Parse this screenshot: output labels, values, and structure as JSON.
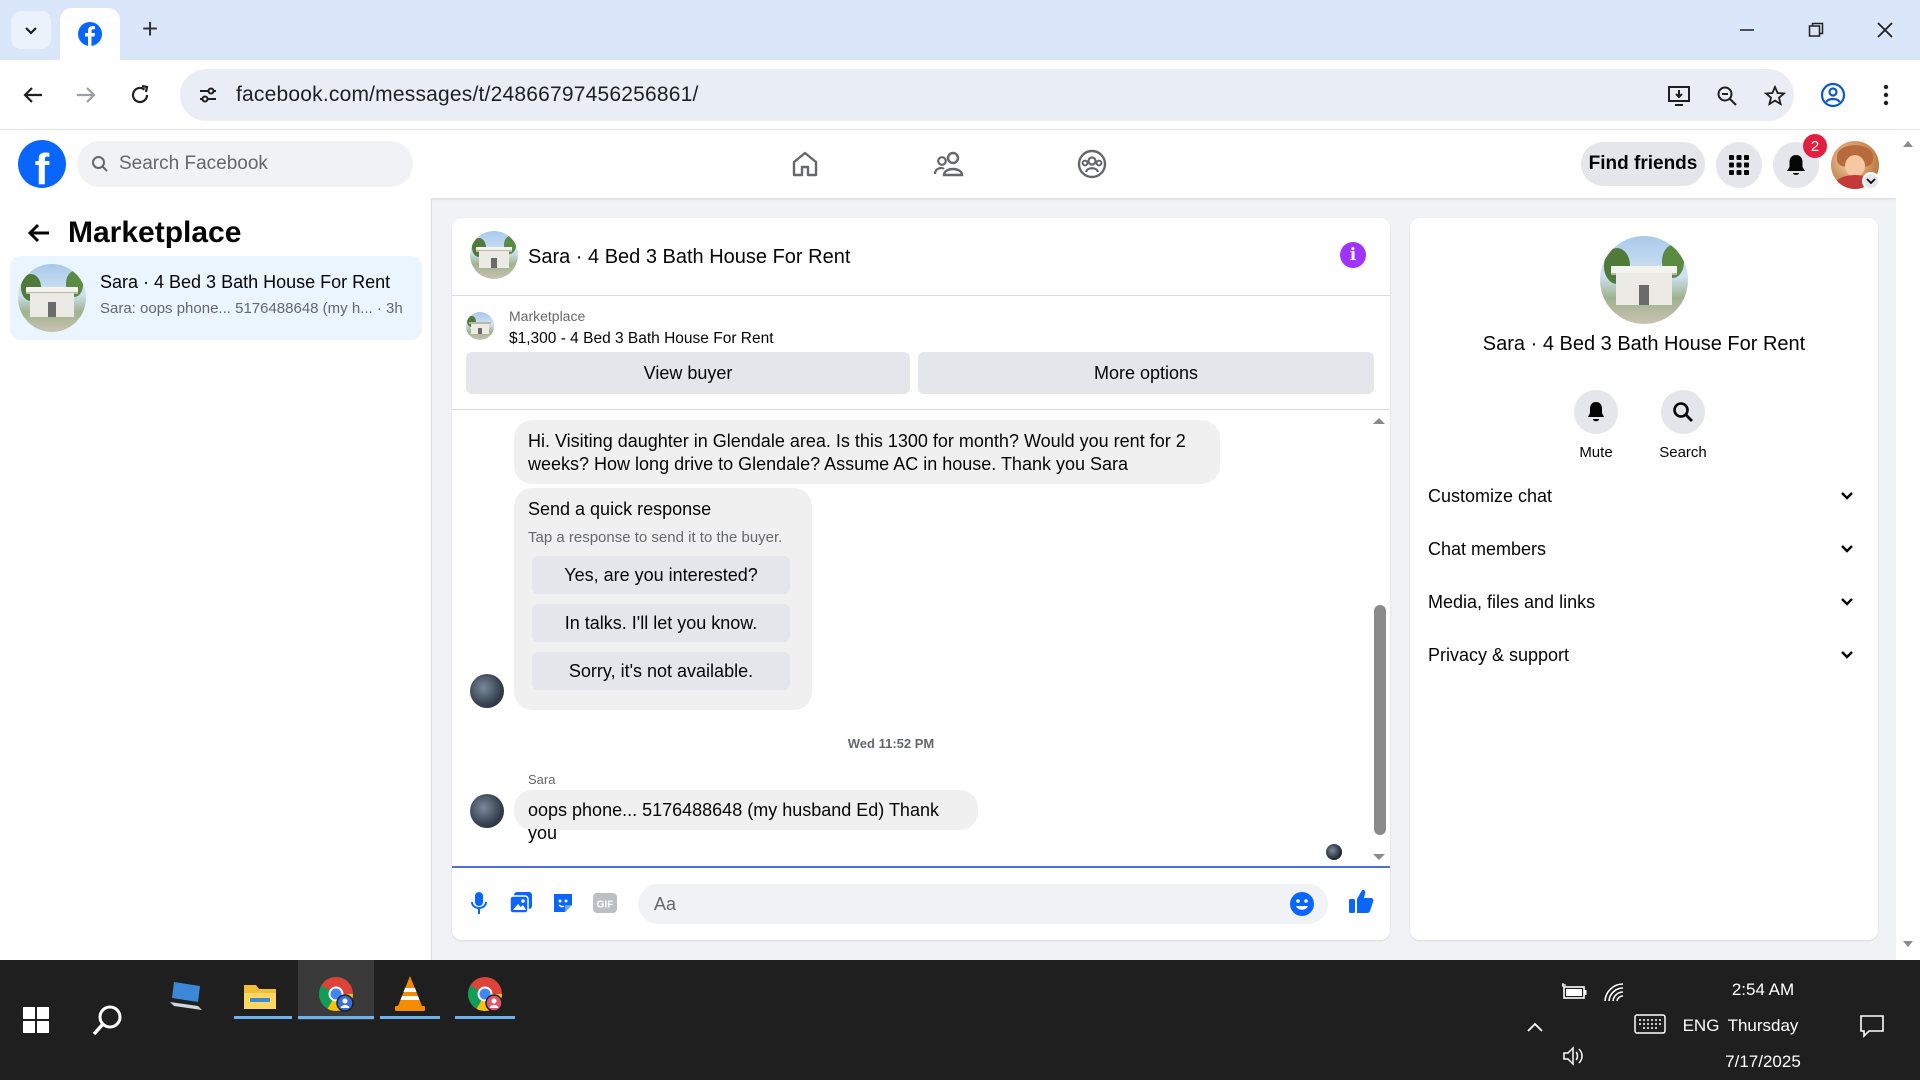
{
  "browser": {
    "url": "facebook.com/messages/t/24866797456256861/",
    "new_tab": "+"
  },
  "facebook": {
    "logo": "f",
    "search_placeholder": "Search Facebook",
    "find_friends": "Find friends",
    "notification_count": "2"
  },
  "sidebar": {
    "title": "Marketplace",
    "conversation": {
      "name": "Sara · 4 Bed 3 Bath House For Rent",
      "snippet": "Sara: oops phone... 5176488648 (my h... · 3h"
    }
  },
  "chat": {
    "title": "Sara · 4 Bed 3 Bath House For Rent",
    "marketplace_label": "Marketplace",
    "listing": "$1,300 - 4 Bed 3 Bath House For Rent",
    "view_buyer": "View buyer",
    "more_options": "More options",
    "message1_line1": "Hi. Visiting daughter in Glendale area. Is this 1300 for month? Would you rent for 2",
    "message1_line2": "weeks? How long drive to Glendale? Assume AC in house. Thank you Sara",
    "quick_response": {
      "title": "Send a quick response",
      "subtitle": "Tap a response to send it to the buyer.",
      "options": [
        "Yes, are you interested?",
        "In talks. I'll let you know.",
        "Sorry, it's not available."
      ]
    },
    "timestamp": "Wed 11:52 PM",
    "sender": "Sara",
    "message2": "oops phone... 5176488648 (my husband Ed) Thank you",
    "composer_placeholder": "Aa"
  },
  "details": {
    "title": "Sara · 4 Bed 3 Bath House For Rent",
    "mute": "Mute",
    "search": "Search",
    "sections": [
      "Customize chat",
      "Chat members",
      "Media, files and links",
      "Privacy & support"
    ]
  },
  "taskbar": {
    "time": "2:54 AM",
    "day": "Thursday",
    "date": "7/17/2025",
    "language": "ENG"
  },
  "colors": {
    "facebook_blue": "#0866ff",
    "messenger_purple": "#a033ff",
    "chat_bubble": "#f0f0f0",
    "selected_conversation": "#ebf5ff",
    "notification_red": "#e41e3f"
  }
}
